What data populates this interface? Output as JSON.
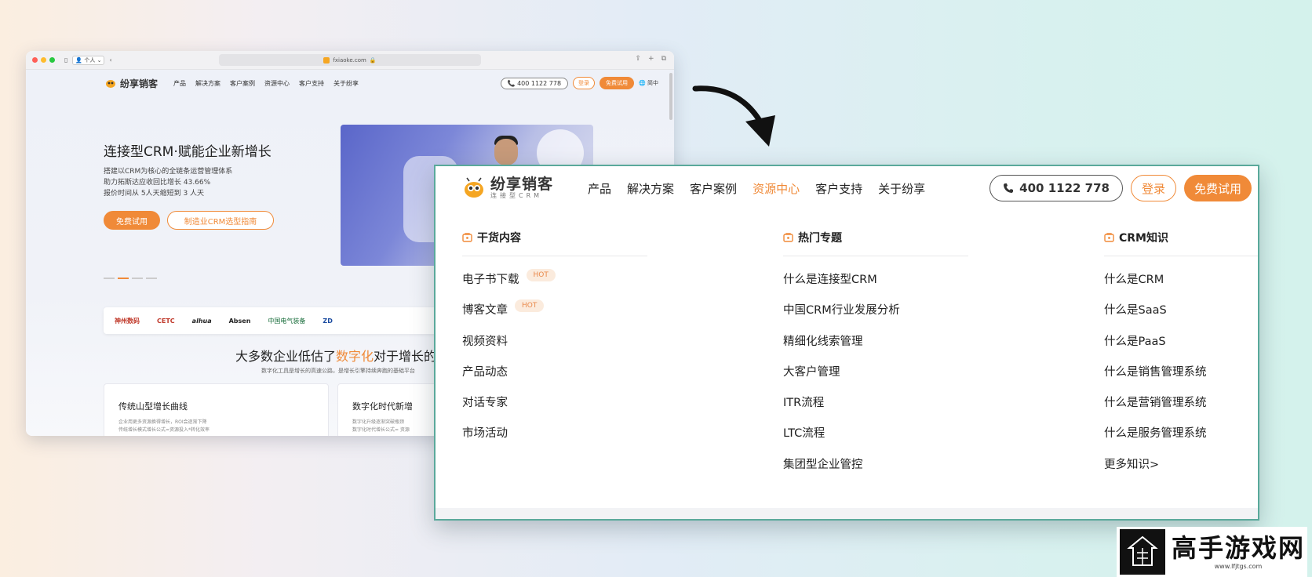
{
  "colors": {
    "accent": "#f08a38",
    "frame": "#5aa99b",
    "hot_bg": "#fbebdd"
  },
  "browser": {
    "profile": "个人",
    "url": "fxiaoke.com",
    "nav": {
      "brand": "纷享销客",
      "menu": [
        "产品",
        "解决方案",
        "客户案例",
        "资源中心",
        "客户支持",
        "关于纷享"
      ],
      "phone": "400 1122 778",
      "login": "登录",
      "trial": "免费试用",
      "lang": "简中"
    },
    "hero": {
      "title": "连接型CRM·赋能企业新增长",
      "lines": [
        "搭建以CRM为核心的全链条运营管理体系",
        "助力拓斯达应收回比增长 43.66%",
        "报价时间从 5人天缩短到 3 人天"
      ],
      "btn_trial": "免费试用",
      "btn_guide": "制造业CRM选型指南"
    },
    "logos": [
      "神州数码",
      "CETC",
      "alhua",
      "Absen",
      "中国电气装备",
      "ZD"
    ],
    "section": {
      "title_pre": "大多数企业低估了",
      "title_hl": "数字化",
      "title_post": "对于增长的",
      "subtitle": "数字化工具是增长的高速公路，是增长引擎持续奔跑的基础平台"
    },
    "cards": [
      {
        "title": "传统山型增长曲线",
        "desc1": "企业用更多资源换得增长，ROI会逐渐下降",
        "desc2": "传统增长模式增长公式=资源投入*转化效率"
      },
      {
        "title": "数字化时代新增",
        "desc1": "数字化升级逐渐突破瓶颈",
        "desc2": "数字化时代增长公式= 资源"
      }
    ]
  },
  "zoom": {
    "brand": "纷享销客",
    "tagline": "连接型CRM",
    "menu": [
      "产品",
      "解决方案",
      "客户案例",
      "资源中心",
      "客户支持",
      "关于纷享"
    ],
    "active_menu": "资源中心",
    "phone": "400 1122 778",
    "login": "登录",
    "trial": "免费试用",
    "columns": [
      {
        "title": "干货内容",
        "items": [
          {
            "label": "电子书下载",
            "badge": "HOT"
          },
          {
            "label": "博客文章",
            "badge": "HOT"
          },
          {
            "label": "视频资料"
          },
          {
            "label": "产品动态"
          },
          {
            "label": "对话专家"
          },
          {
            "label": "市场活动"
          }
        ]
      },
      {
        "title": "热门专题",
        "items": [
          {
            "label": "什么是连接型CRM"
          },
          {
            "label": "中国CRM行业发展分析"
          },
          {
            "label": "精细化线索管理"
          },
          {
            "label": "大客户管理"
          },
          {
            "label": "ITR流程"
          },
          {
            "label": "LTC流程"
          },
          {
            "label": "集团型企业管控"
          }
        ]
      },
      {
        "title": "CRM知识",
        "items": [
          {
            "label": "什么是CRM"
          },
          {
            "label": "什么是SaaS"
          },
          {
            "label": "什么是PaaS"
          },
          {
            "label": "什么是销售管理系统"
          },
          {
            "label": "什么是营销管理系统"
          },
          {
            "label": "什么是服务管理系统"
          },
          {
            "label": "更多知识>"
          }
        ]
      }
    ]
  },
  "watermark": {
    "name": "高手游戏网",
    "url": "www.lfjtgs.com"
  }
}
